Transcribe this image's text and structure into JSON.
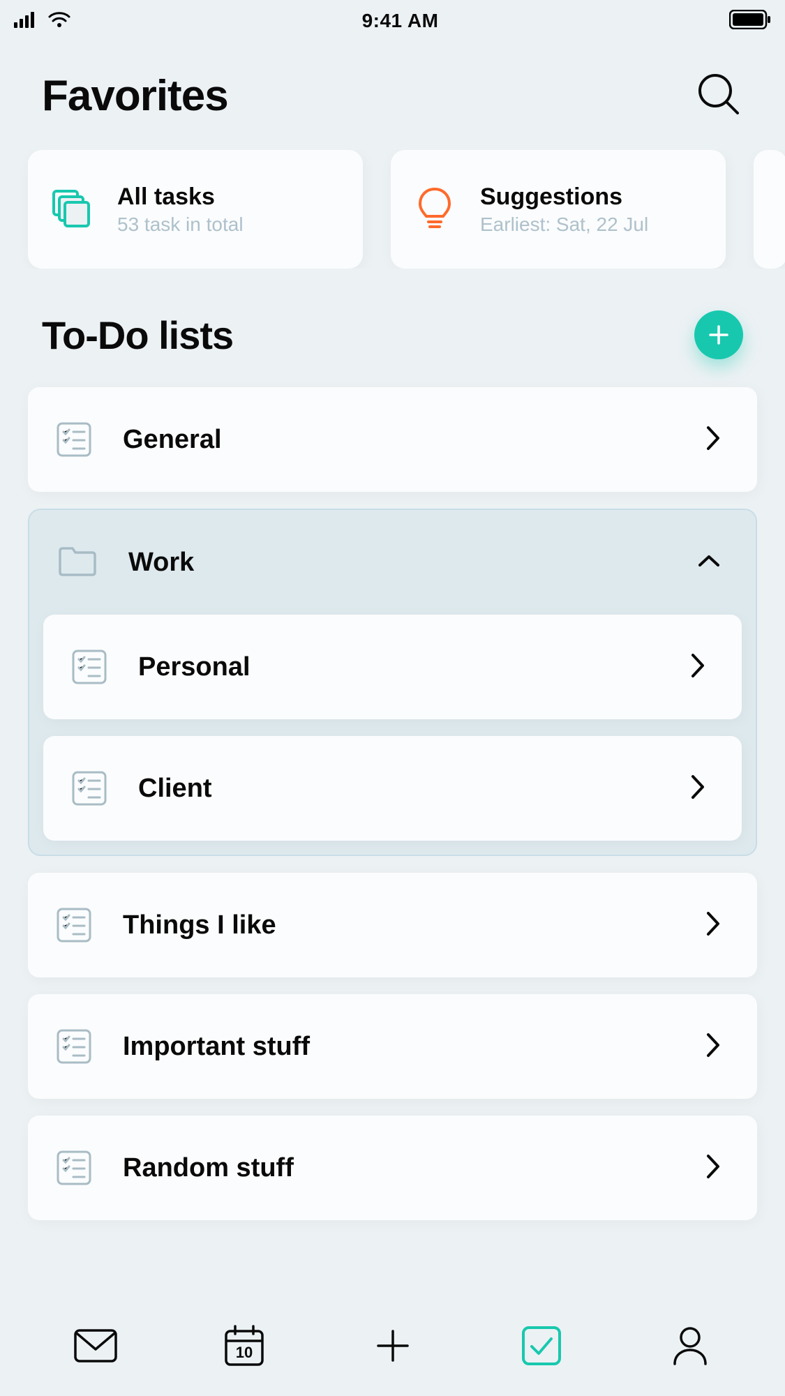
{
  "status": {
    "time": "9:41 AM"
  },
  "header": {
    "title": "Favorites"
  },
  "fav_cards": [
    {
      "title": "All tasks",
      "subtitle": "53 task in total"
    },
    {
      "title": "Suggestions",
      "subtitle": "Earliest: Sat, 22 Jul"
    }
  ],
  "section": {
    "title": "To-Do lists"
  },
  "lists": {
    "general": "General",
    "folder": {
      "name": "Work",
      "children": [
        "Personal",
        "Client"
      ]
    },
    "rest": [
      "Things I like",
      "Important stuff",
      "Random stuff"
    ]
  },
  "tabs": {
    "calendar_day": "10"
  },
  "colors": {
    "accent": "#18C8AE",
    "suggestion": "#FF6A2C",
    "icon_gray": "#A8BCC5"
  }
}
